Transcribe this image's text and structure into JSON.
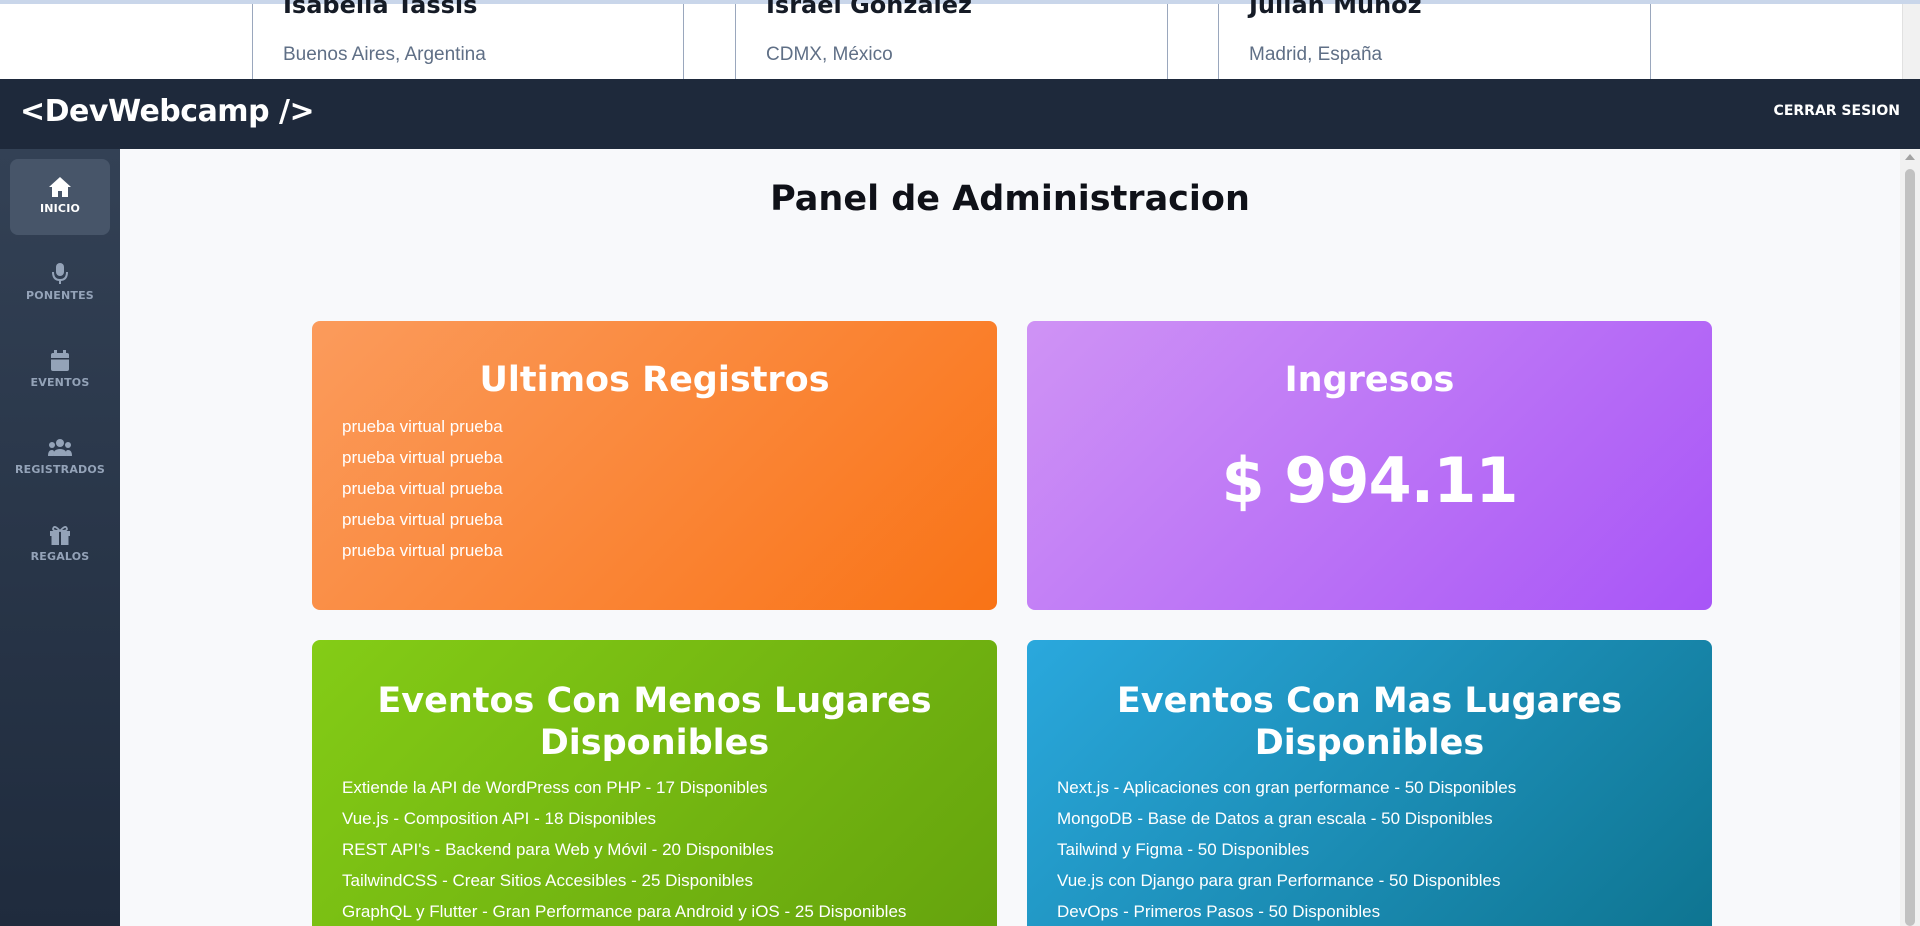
{
  "speakers": [
    {
      "name": "Isabella Tassis",
      "location": "Buenos Aires, Argentina"
    },
    {
      "name": "Israel González",
      "location": "CDMX, México"
    },
    {
      "name": "Julián Muñoz",
      "location": "Madrid, España"
    }
  ],
  "header": {
    "logo": "<DevWebcamp />",
    "logout_label": "CERRAR SESION"
  },
  "sidebar": {
    "items": [
      {
        "label": "INICIO",
        "icon": "home-icon",
        "active": true
      },
      {
        "label": "PONENTES",
        "icon": "microphone-icon",
        "active": false
      },
      {
        "label": "EVENTOS",
        "icon": "calendar-icon",
        "active": false
      },
      {
        "label": "REGISTRADOS",
        "icon": "users-icon",
        "active": false
      },
      {
        "label": "REGALOS",
        "icon": "gift-icon",
        "active": false
      }
    ]
  },
  "main": {
    "title": "Panel de Administracion",
    "registros": {
      "title": "Ultimos Registros",
      "items": [
        "prueba virtual prueba",
        "prueba virtual prueba",
        "prueba virtual prueba",
        "prueba virtual prueba",
        "prueba virtual prueba"
      ]
    },
    "ingresos": {
      "title": "Ingresos",
      "amount": "$ 994.11"
    },
    "menos_lugares": {
      "title": "Eventos Con Menos Lugares Disponibles",
      "items": [
        "Extiende la API de WordPress con PHP - 17 Disponibles",
        "Vue.js - Composition API - 18 Disponibles",
        "REST API's - Backend para Web y Móvil - 20 Disponibles",
        "TailwindCSS - Crear Sitios Accesibles - 25 Disponibles",
        "GraphQL y Flutter - Gran Performance para Android y iOS - 25 Disponibles"
      ]
    },
    "mas_lugares": {
      "title": "Eventos Con Mas Lugares Disponibles",
      "items": [
        "Next.js - Aplicaciones con gran performance - 50 Disponibles",
        "MongoDB - Base de Datos a gran escala - 50 Disponibles",
        "Tailwind y Figma - 50 Disponibles",
        "Vue.js con Django para gran Performance - 50 Disponibles",
        "DevOps - Primeros Pasos - 50 Disponibles"
      ]
    }
  },
  "colors": {
    "header_bg": "#1e293b",
    "sidebar_bg": "#334155",
    "orange": "#f97316",
    "purple": "#a855f7",
    "green": "#84cc16",
    "blue": "#0e7490"
  }
}
